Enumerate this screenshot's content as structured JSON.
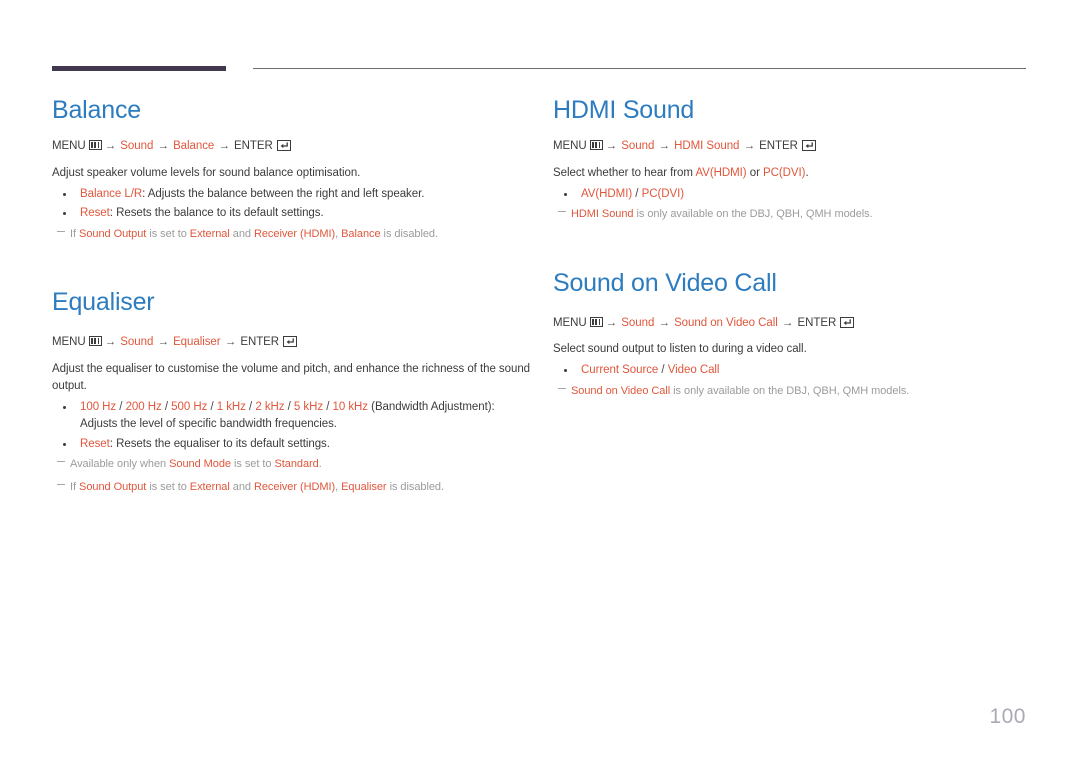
{
  "document": {
    "page_number": "100",
    "accent_blue": "#2d7cc0",
    "accent_orange": "#e0573c",
    "note_gray": "#9b9b9b",
    "rule_dark": "#413850"
  },
  "icons": {
    "menu": "menu-grid-icon",
    "enter": "enter-return-icon"
  },
  "common": {
    "menu_label": "MENU",
    "enter_label": "ENTER",
    "arrow": "→",
    "sound": "Sound",
    "reset_label": "Reset"
  },
  "sections": {
    "balance": {
      "title": "Balance",
      "path": {
        "menu": "MENU",
        "step1": "Sound",
        "step2": "Balance",
        "enter": "ENTER"
      },
      "lead": "Adjust speaker volume levels for sound balance optimisation.",
      "bullets": [
        {
          "term": "Balance L/R",
          "rest": ": Adjusts the balance between the right and left speaker."
        },
        {
          "term": "Reset",
          "rest": ": Resets the balance to its default settings."
        }
      ],
      "notes": [
        {
          "parts": [
            {
              "t": "If ",
              "hl": false
            },
            {
              "t": "Sound Output",
              "hl": true
            },
            {
              "t": " is set to ",
              "hl": false
            },
            {
              "t": "External",
              "hl": true
            },
            {
              "t": " and ",
              "hl": false
            },
            {
              "t": "Receiver (HDMI)",
              "hl": true
            },
            {
              "t": ", ",
              "hl": false
            },
            {
              "t": "Balance",
              "hl": true
            },
            {
              "t": " is disabled.",
              "hl": false
            }
          ]
        }
      ]
    },
    "equaliser": {
      "title": "Equaliser",
      "path": {
        "menu": "MENU",
        "step1": "Sound",
        "step2": "Equaliser",
        "enter": "ENTER"
      },
      "lead": "Adjust the equaliser to customise the volume and pitch, and enhance the richness of the sound output.",
      "frequencies": [
        "100 Hz",
        "200 Hz",
        "500 Hz",
        "1 kHz",
        "2 kHz",
        "5 kHz",
        "10 kHz"
      ],
      "frequency_rest": " (Bandwidth Adjustment): Adjusts the level of specific bandwidth frequencies.",
      "bullets": [
        {
          "term": "Reset",
          "rest": ": Resets the equaliser to its default settings."
        }
      ],
      "notes": [
        {
          "parts": [
            {
              "t": "Available only when ",
              "hl": false
            },
            {
              "t": "Sound Mode",
              "hl": true
            },
            {
              "t": " is set to ",
              "hl": false
            },
            {
              "t": "Standard",
              "hl": true
            },
            {
              "t": ".",
              "hl": false
            }
          ]
        },
        {
          "parts": [
            {
              "t": "If ",
              "hl": false
            },
            {
              "t": "Sound Output",
              "hl": true
            },
            {
              "t": " is set to ",
              "hl": false
            },
            {
              "t": "External",
              "hl": true
            },
            {
              "t": " and ",
              "hl": false
            },
            {
              "t": "Receiver (HDMI)",
              "hl": true
            },
            {
              "t": ", ",
              "hl": false
            },
            {
              "t": "Equaliser",
              "hl": true
            },
            {
              "t": " is disabled.",
              "hl": false
            }
          ]
        }
      ]
    },
    "hdmi_sound": {
      "title": "HDMI Sound",
      "path": {
        "menu": "MENU",
        "step1": "Sound",
        "step2": "HDMI Sound",
        "enter": "ENTER"
      },
      "lead_parts": [
        {
          "t": "Select whether to hear from ",
          "hl": false
        },
        {
          "t": "AV(HDMI)",
          "hl": true
        },
        {
          "t": " or ",
          "hl": false
        },
        {
          "t": "PC(DVI)",
          "hl": true
        },
        {
          "t": ".",
          "hl": false
        }
      ],
      "options": [
        "AV(HDMI)",
        "PC(DVI)"
      ],
      "notes": [
        {
          "parts": [
            {
              "t": "HDMI Sound",
              "hl": true
            },
            {
              "t": " is only available on the DBJ, QBH, QMH models.",
              "hl": false
            }
          ]
        }
      ]
    },
    "sound_on_video_call": {
      "title": "Sound on Video Call",
      "path": {
        "menu": "MENU",
        "step1": "Sound",
        "step2": "Sound on Video Call",
        "enter": "ENTER"
      },
      "lead": "Select sound output to listen to during a video call.",
      "options": [
        "Current Source",
        "Video Call"
      ],
      "notes": [
        {
          "parts": [
            {
              "t": "Sound on Video Call",
              "hl": true
            },
            {
              "t": " is only available on the DBJ, QBH, QMH models.",
              "hl": false
            }
          ]
        }
      ]
    }
  }
}
